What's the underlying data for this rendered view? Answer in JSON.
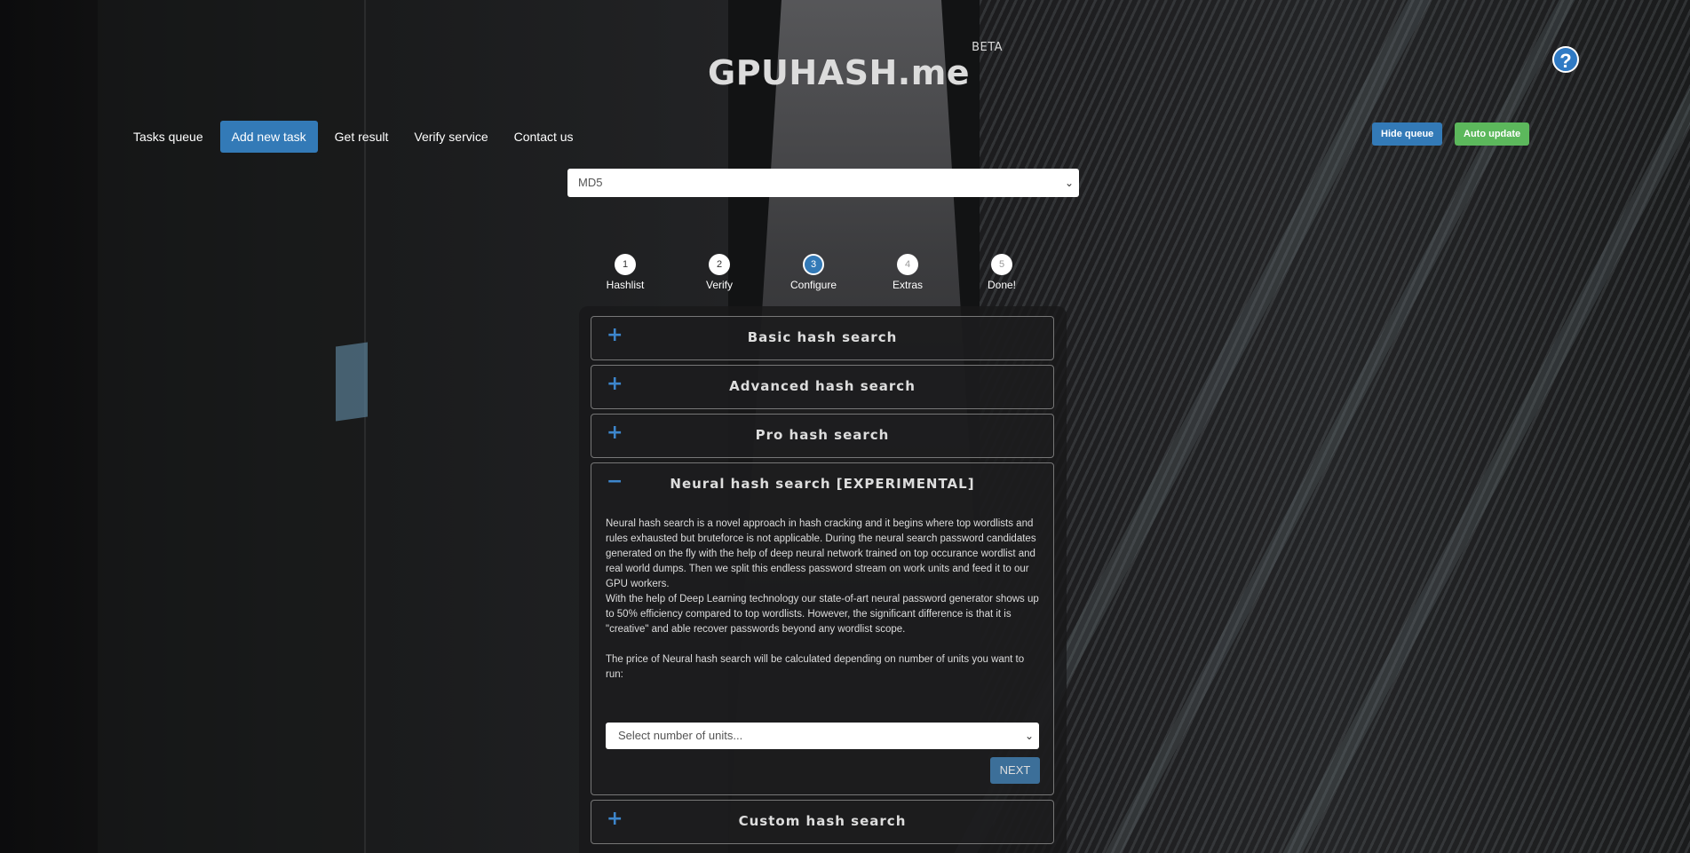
{
  "app": {
    "logo": "GPUHASH.me",
    "logo_badge": "BETA"
  },
  "nav": {
    "items": [
      {
        "label": "Tasks queue",
        "active": false
      },
      {
        "label": "Add new task",
        "active": true
      },
      {
        "label": "Get result",
        "active": false
      },
      {
        "label": "Verify service",
        "active": false
      },
      {
        "label": "Contact us",
        "active": false
      }
    ]
  },
  "toolbar": {
    "hide_queue": "Hide queue",
    "auto_update": "Auto update",
    "help_icon": "question-circle-icon"
  },
  "hash_type": {
    "selected": "MD5"
  },
  "steps": [
    {
      "num": "1",
      "label": "Hashlist",
      "state": "done"
    },
    {
      "num": "2",
      "label": "Verify",
      "state": "done"
    },
    {
      "num": "3",
      "label": "Configure",
      "state": "current"
    },
    {
      "num": "4",
      "label": "Extras",
      "state": "todo"
    },
    {
      "num": "5",
      "label": "Done!",
      "state": "todo"
    }
  ],
  "accordion": {
    "basic": {
      "sign": "+",
      "title": "Basic hash search"
    },
    "advanced": {
      "sign": "+",
      "title": "Advanced hash search"
    },
    "pro": {
      "sign": "+",
      "title": "Pro hash search"
    },
    "neural": {
      "sign": "−",
      "title": "Neural hash search [EXPERIMENTAL]",
      "para1": "Neural hash search is a novel approach in hash cracking and it begins where top wordlists and rules exhausted but bruteforce is not applicable. During the neural search password candidates generated on the fly with the help of deep neural network trained on top occurance wordlist and real world dumps. Then we split this endless password stream on work units and feed it to our GPU workers.",
      "para2": "With the help of Deep Learning technology our state-of-art neural password generator shows up to 50% efficiency compared to top wordlists. However, the significant difference is that it is \"creative\" and able recover passwords beyond any wordlist scope.",
      "para3": "The price of Neural hash search will be calculated depending on number of units you want to run:",
      "units_placeholder": "Select number of units...",
      "next_label": "NEXT"
    },
    "custom": {
      "sign": "+",
      "title": "Custom hash search"
    }
  }
}
